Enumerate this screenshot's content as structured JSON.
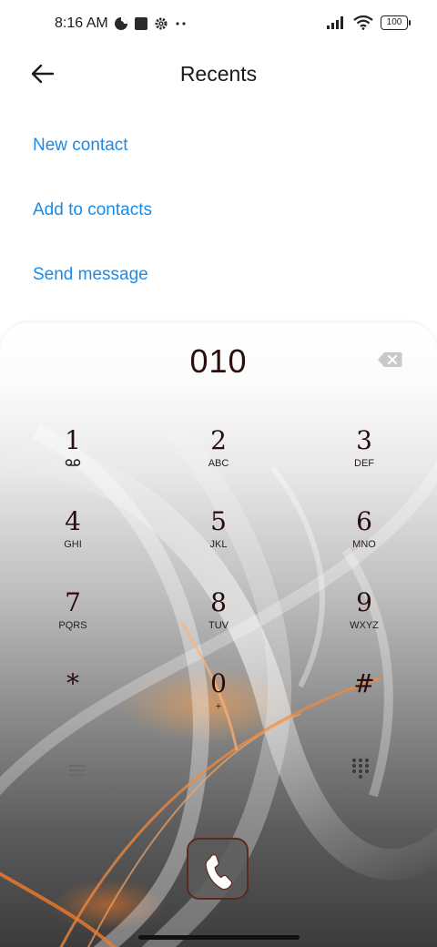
{
  "status_bar": {
    "time": "8:16 AM",
    "battery": "100",
    "icons": [
      "data-saver-icon",
      "square-notification-icon",
      "settings-gear-icon",
      "more-dots-icon",
      "signal-bars-icon",
      "wifi-icon",
      "battery-icon"
    ]
  },
  "header": {
    "title": "Recents",
    "back_icon": "arrow-left-icon"
  },
  "actions": [
    {
      "label": "New contact"
    },
    {
      "label": "Add to contacts"
    },
    {
      "label": "Send message"
    }
  ],
  "dialer": {
    "number": "010",
    "backspace_icon": "backspace-icon",
    "keys": [
      {
        "digit": "1",
        "letters": "",
        "sub_icon": "voicemail-icon"
      },
      {
        "digit": "2",
        "letters": "ABC"
      },
      {
        "digit": "3",
        "letters": "DEF"
      },
      {
        "digit": "4",
        "letters": "GHI"
      },
      {
        "digit": "5",
        "letters": "JKL"
      },
      {
        "digit": "6",
        "letters": "MNO"
      },
      {
        "digit": "7",
        "letters": "PQRS"
      },
      {
        "digit": "8",
        "letters": "TUV"
      },
      {
        "digit": "9",
        "letters": "WXYZ"
      },
      {
        "digit": "*",
        "letters": ""
      },
      {
        "digit": "0",
        "letters": "+"
      },
      {
        "digit": "#",
        "letters": ""
      }
    ],
    "menu_icon": "menu-lines-icon",
    "keypad_toggle_icon": "dialpad-grid-icon",
    "call_icon": "phone-handset-icon"
  },
  "colors": {
    "link": "#1a8be8",
    "digit": "#2b0c0c",
    "accent_orange": "#f08a3a"
  }
}
